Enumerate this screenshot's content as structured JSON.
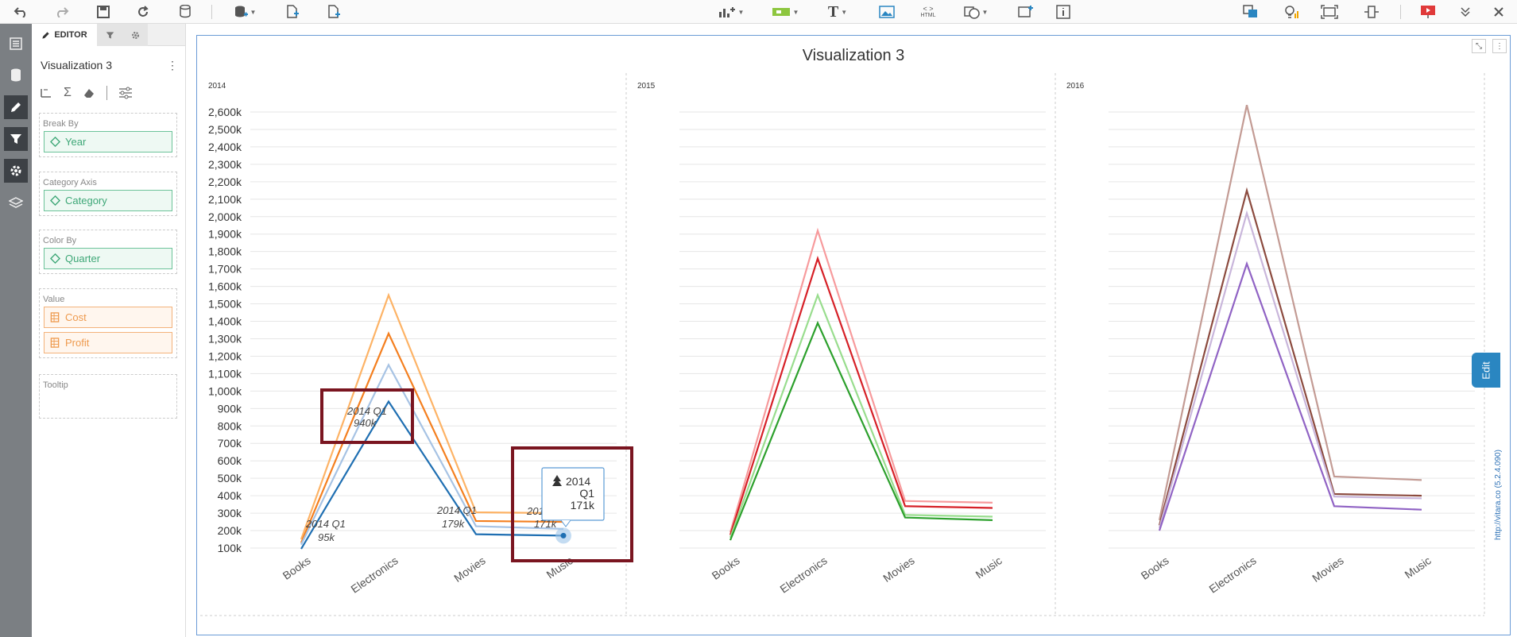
{
  "toolbar": {
    "html_label": "HTML"
  },
  "panel": {
    "tab_editor": "EDITOR",
    "title": "Visualization 3",
    "break_by_label": "Break By",
    "break_by_value": "Year",
    "category_axis_label": "Category Axis",
    "category_axis_value": "Category",
    "color_by_label": "Color By",
    "color_by_value": "Quarter",
    "value_label": "Value",
    "value_items": [
      "Cost",
      "Profit"
    ],
    "tooltip_label": "Tooltip"
  },
  "canvas": {
    "title": "Visualization 3",
    "edit_label": "Edit",
    "watermark": "http://vitara.co (5.2.4.090)"
  },
  "chart_data": {
    "type": "line",
    "title": "Visualization 3",
    "categories": [
      "Books",
      "Electronics",
      "Movies",
      "Music"
    ],
    "y_ticks": [
      "100k",
      "200k",
      "300k",
      "400k",
      "500k",
      "600k",
      "700k",
      "800k",
      "900k",
      "1,000k",
      "1,100k",
      "1,200k",
      "1,300k",
      "1,400k",
      "1,500k",
      "1,600k",
      "1,700k",
      "1,800k",
      "1,900k",
      "2,000k",
      "2,100k",
      "2,200k",
      "2,300k",
      "2,400k",
      "2,500k",
      "2,600k"
    ],
    "ylim": [
      100,
      2600
    ],
    "panels": [
      {
        "label": "2014",
        "series": [
          {
            "color": "#fdb366",
            "values": [
              150,
              1550,
              305,
              300
            ]
          },
          {
            "color": "#f47f1f",
            "values": [
              130,
              1330,
              255,
              250
            ]
          },
          {
            "color": "#a7c3e4",
            "values": [
              120,
              1150,
              225,
              210
            ]
          },
          {
            "color": "#1f6fb2",
            "values": [
              95,
              940,
              179,
              171
            ]
          }
        ],
        "annotations": [
          {
            "line1": "2014 Q1",
            "line2": "95k"
          },
          {
            "line1": "2014 Q1",
            "line2": "940k"
          },
          {
            "line1": "2014 Q1",
            "line2": "179k"
          },
          {
            "line1": "2014 Q1",
            "line2": "171k"
          }
        ],
        "tooltip": {
          "line1": "2014",
          "line2": "Q1",
          "line3": "171k"
        }
      },
      {
        "label": "2015",
        "series": [
          {
            "color": "#f79a9c",
            "values": [
              190,
              1920,
              370,
              360
            ]
          },
          {
            "color": "#d62027",
            "values": [
              175,
              1760,
              340,
              330
            ]
          },
          {
            "color": "#99dd8e",
            "values": [
              160,
              1550,
              290,
              280
            ]
          },
          {
            "color": "#2ca02c",
            "values": [
              145,
              1390,
              275,
              260
            ]
          }
        ]
      },
      {
        "label": "2016",
        "series": [
          {
            "color": "#c39b94",
            "values": [
              260,
              2640,
              510,
              490
            ]
          },
          {
            "color": "#8c4b3f",
            "values": [
              230,
              2150,
              410,
              400
            ]
          },
          {
            "color": "#c9b6db",
            "values": [
              215,
              2020,
              395,
              385
            ]
          },
          {
            "color": "#9063c4",
            "values": [
              200,
              1730,
              340,
              320
            ]
          }
        ]
      }
    ]
  }
}
